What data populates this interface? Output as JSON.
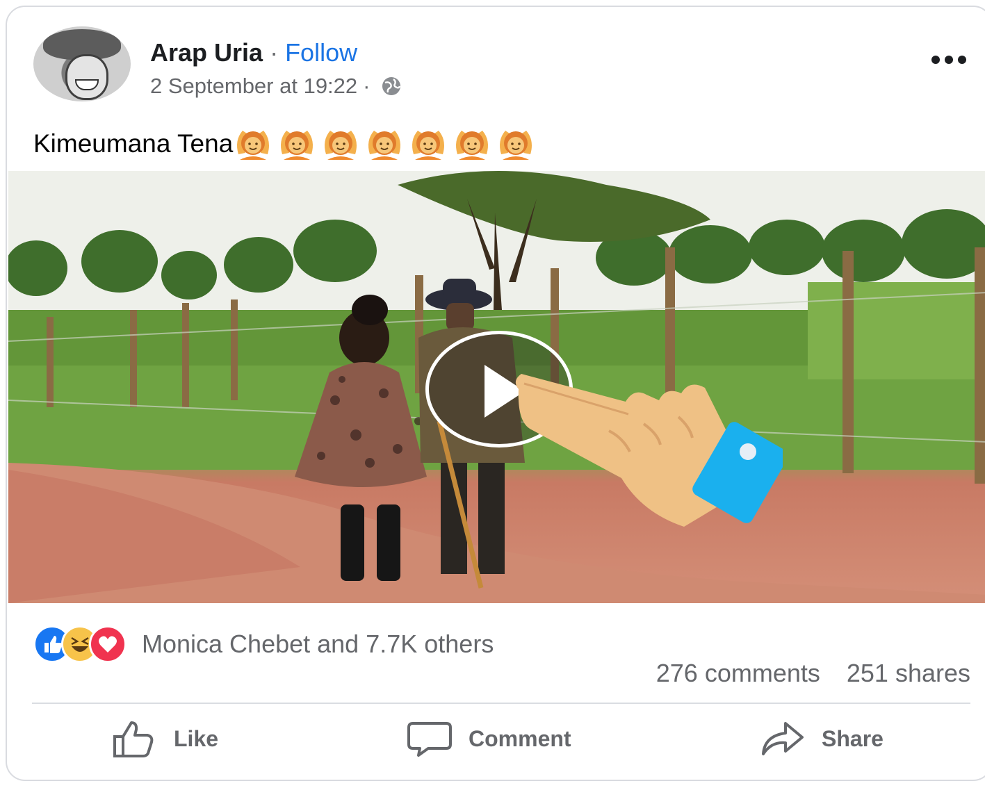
{
  "post": {
    "author": "Arap Uria",
    "separator": "·",
    "follow_label": "Follow",
    "timestamp": "2 September at 19:22",
    "meta_separator": "·",
    "privacy_icon": "globe-icon",
    "text": "Kimeumana Tena",
    "text_emoji": "woman-raising-hands-emoji",
    "text_emoji_count": 7
  },
  "video": {
    "play_icon": "play-icon",
    "overlay_icon": "pointing-hand-icon"
  },
  "reactions": {
    "icons": [
      "like-icon",
      "haha-icon",
      "love-icon"
    ],
    "summary": "Monica Chebet and 7.7K others"
  },
  "stats": {
    "comments": "276 comments",
    "shares": "251 shares"
  },
  "actions": {
    "like_label": "Like",
    "comment_label": "Comment",
    "share_label": "Share"
  },
  "colors": {
    "link_blue": "#1b74e4",
    "secondary_text": "#65676b",
    "like_blue": "#1877f2",
    "love_red": "#f0334f",
    "haha_yellow": "#f7c34a",
    "watch_band": "#1ab0ee"
  }
}
